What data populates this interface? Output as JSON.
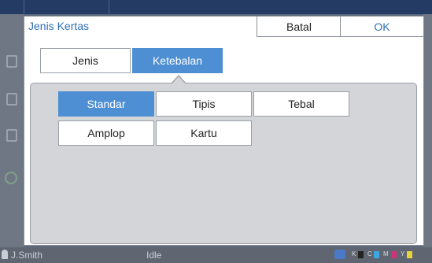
{
  "background": {
    "user_name": "J.Smith",
    "status_text": "Idle",
    "ink_labels": [
      "K",
      "C",
      "M",
      "Y"
    ],
    "ink_colors": [
      "#222222",
      "#3ba7de",
      "#d0317a",
      "#e7d33a"
    ]
  },
  "dialog": {
    "title": "Jenis Kertas",
    "cancel_label": "Batal",
    "ok_label": "OK"
  },
  "tabs": [
    {
      "label": "Jenis",
      "active": false
    },
    {
      "label": "Ketebalan",
      "active": true
    }
  ],
  "options": [
    {
      "label": "Standar",
      "selected": true
    },
    {
      "label": "Tipis",
      "selected": false
    },
    {
      "label": "Tebal",
      "selected": false
    },
    {
      "label": "Amplop",
      "selected": false
    },
    {
      "label": "Kartu",
      "selected": false
    }
  ],
  "colors": {
    "accent": "#4e8fd3",
    "title_blue": "#2e6fb8",
    "panel_bg": "#d3d5d8"
  }
}
